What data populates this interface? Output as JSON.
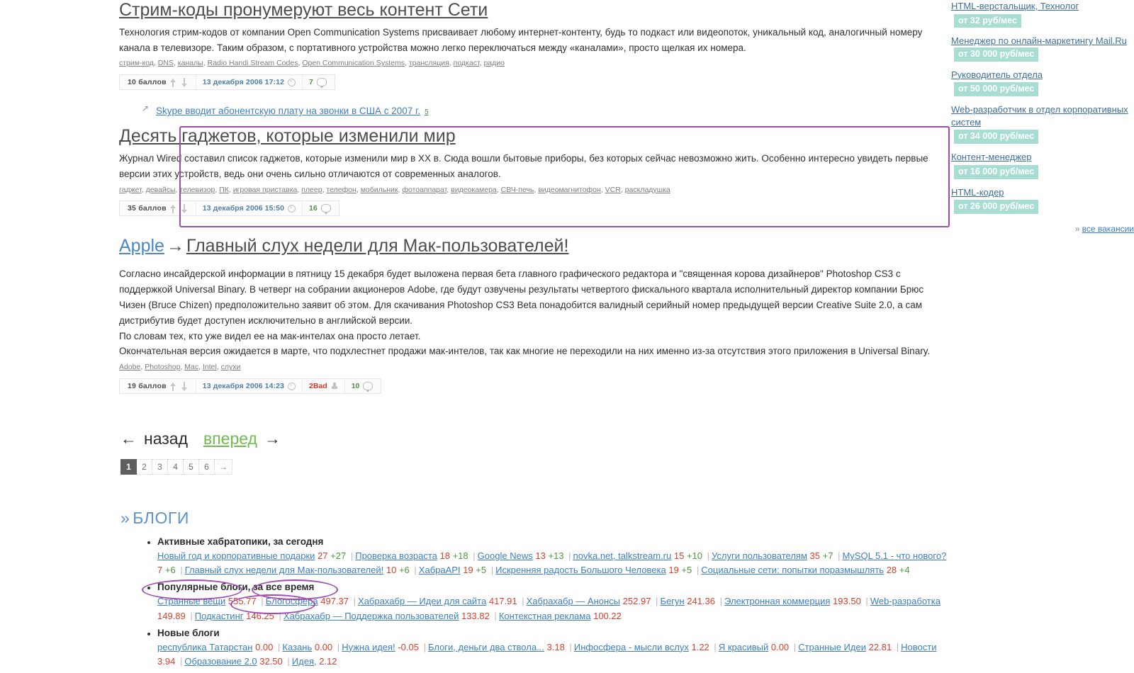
{
  "posts": [
    {
      "title": "Стрим-коды пронумеруют весь контент Сети",
      "body": "Технология стрим-кодов от компании Open Communication Systems присваивает любому интернет-контенту, будь то подкаст или видеопоток, уникальный код, аналогичный номеру канала в телевизоре. Таким образом, с портативного устройства можно легко переключаться между «каналами», просто щелкая их номера.",
      "tags": [
        "стрим-код",
        "DNS",
        "каналы",
        "Radio Handi Stream Codes",
        "Open Communication Systems",
        "трансляция",
        "подкаст",
        "радио"
      ],
      "score": "10 баллов",
      "date": "13 декабря 2006 17:12",
      "comments": "7"
    },
    {
      "title": "Десять гаджетов, которые изменили мир",
      "body": "Журнал Wired составил список гаджетов, которые изменили мир в XX в. Сюда вошли бытовые приборы, без которых сейчас невозможно жить. Особенно интересно увидеть первые версии этих устройств, ведь они очень сильно отличаются от современных аналогов.",
      "tags": [
        "гаджет",
        "девайсы",
        "телевизор",
        "ПК",
        "игровая приставка",
        "плеер",
        "телефон",
        "мобильник",
        "фотоаппарат",
        "видеокамера",
        "СВЧ-печь",
        "видеомагнитофон",
        "VCR",
        "раскладушка"
      ],
      "score": "35 баллов",
      "date": "13 декабря 2006 15:50",
      "comments": "16"
    }
  ],
  "teaser": {
    "link": "Skype вводит абонентскую плату на звонки в США с 2007 г.",
    "count": "5"
  },
  "apple_post": {
    "blog": "Apple",
    "arrow": "→",
    "title": "Главный слух недели для Мак-пользователей!",
    "paragraphs": [
      "Согласно инсайдерской информации в пятницу 15 декабря будет выложена первая бета главного графического редактора и \"священная корова дизайнеров\" Photoshop CS3 с поддержкой Universal Binary. В четверг на собрании акционеров Adobe, где будут озвучены результаты четвертого фискального квартала исполнительный директор компании Брюс Чизен (Bruce Chizen) предположительно заявит об этом. Для скачивания Photoshop CS3 Beta понадобится валидный серийный номер предыдущей версии Creative Suite 2.0, а сам дистрибутив будет доступен исключительно в английской версии.",
      "По словам тех, кто уже видел ее на мак-интелах она просто летает.",
      "Окончательная версия ожидается в марте, что подхлестнет продажи мак-интелов, так как многие не переходили на них именно из-за отсутствия этого приложения в Universal Binary."
    ],
    "tags": [
      "Adobe",
      "Photoshop",
      "Mac",
      "Intel",
      "слухи"
    ],
    "score": "19 баллов",
    "date": "13 декабря 2006 14:23",
    "bad": "2Bad",
    "comments": "10"
  },
  "nav": {
    "back_arrow": "←",
    "back": "назад",
    "forward": "вперед",
    "forward_arrow": "→"
  },
  "pager": {
    "pages": [
      "1",
      "2",
      "3",
      "4",
      "5",
      "6"
    ],
    "next": "→",
    "current": "1"
  },
  "blogs_section": {
    "heading": "БЛОГИ",
    "chevron": "»",
    "groups": [
      {
        "title": "Активные хабратопики, за сегодня",
        "items": [
          {
            "name": "Новый год и корпоративные подарки",
            "value": "27",
            "delta": "+27"
          },
          {
            "name": "Проверка возраста",
            "value": "18",
            "delta": "+18"
          },
          {
            "name": "Google News",
            "value": "13",
            "delta": "+13"
          },
          {
            "name": "novka.net, talkstream.ru",
            "value": "15",
            "delta": "+10"
          },
          {
            "name": "Услуги пользователям",
            "value": "35",
            "delta": "+7"
          },
          {
            "name": "MySQL 5.1 - что нового?",
            "value": "7",
            "delta": "+6"
          },
          {
            "name": "Главный слух недели для Мак-пользователей!",
            "value": "10",
            "delta": "+6"
          },
          {
            "name": "ХабраAPI",
            "value": "19",
            "delta": "+5"
          },
          {
            "name": "Искренняя радость Большого Человека",
            "value": "19",
            "delta": "+5"
          },
          {
            "name": "Социальные сети: попытки поразмышлять",
            "value": "28",
            "delta": "+4"
          }
        ]
      },
      {
        "title": "Популярные блоги, за все время",
        "items": [
          {
            "name": "Странные вещи",
            "value": "555.77",
            "delta": ""
          },
          {
            "name": "Блогосфера",
            "value": "497.37",
            "delta": ""
          },
          {
            "name": "Хабрахабр — Идеи для сайта",
            "value": "417.91",
            "delta": ""
          },
          {
            "name": "Хабрахабр — Анонсы",
            "value": "252.97",
            "delta": ""
          },
          {
            "name": "Бегун",
            "value": "241.36",
            "delta": ""
          },
          {
            "name": "Электронная коммерция",
            "value": "193.50",
            "delta": ""
          },
          {
            "name": "Web-разработка",
            "value": "149.89",
            "delta": ""
          },
          {
            "name": "Подкастинг",
            "value": "146.25",
            "delta": ""
          },
          {
            "name": "Хабрахабр — Поддержка пользователей",
            "value": "133.82",
            "delta": ""
          },
          {
            "name": "Контекстная реклама",
            "value": "100.22",
            "delta": ""
          }
        ]
      },
      {
        "title": "Новые блоги",
        "items": [
          {
            "name": "республика Татарстан",
            "value": "0.00",
            "delta": ""
          },
          {
            "name": "Казань",
            "value": "0.00",
            "delta": ""
          },
          {
            "name": "Нужна идея!",
            "value": "-0.05",
            "delta": ""
          },
          {
            "name": "Блоги, деньги два ствола...",
            "value": "3.18",
            "delta": ""
          },
          {
            "name": "Инфосфера - мысли вслух",
            "value": "1.22",
            "delta": ""
          },
          {
            "name": "Я красивый",
            "value": "0.00",
            "delta": ""
          },
          {
            "name": "Странные Идеи",
            "value": "22.81",
            "delta": ""
          },
          {
            "name": "Новости",
            "value": "3.94",
            "delta": ""
          },
          {
            "name": "Образование 2.0",
            "value": "32.50",
            "delta": ""
          },
          {
            "name": "Идея,",
            "value": "2.12",
            "delta": ""
          }
        ]
      }
    ]
  },
  "sidebar": {
    "jobs": [
      {
        "title": "HTML-верстальщик, Технолог",
        "salary": "от 32 руб/мес",
        "inline": false
      },
      {
        "title": "Менеджер по онлайн-маркетингу Mail.Ru",
        "salary": "от 30 000 руб/мес",
        "inline": true
      },
      {
        "title": "Руководитель отдела",
        "salary": "от 50 000 руб/мес",
        "inline": false
      },
      {
        "title": "Web-разработчик в отдел корпоративных систем",
        "salary": "от 34 000 руб/мес",
        "inline": false
      },
      {
        "title": "Контент-менеджер",
        "salary": "от 16 000 руб/мес",
        "inline": false
      },
      {
        "title": "HTML-кодер",
        "salary": "от 26 000 руб/мес",
        "inline": false
      }
    ],
    "all_vacancies": "все вакансии",
    "all_vacancies_chevron": "»"
  },
  "colors": {
    "annotation": "#a04bb0",
    "link": "#3b7fc4",
    "value_red": "#d9402b",
    "delta_green": "#4f9a3d",
    "salary_bg": "#a8ddd4"
  }
}
